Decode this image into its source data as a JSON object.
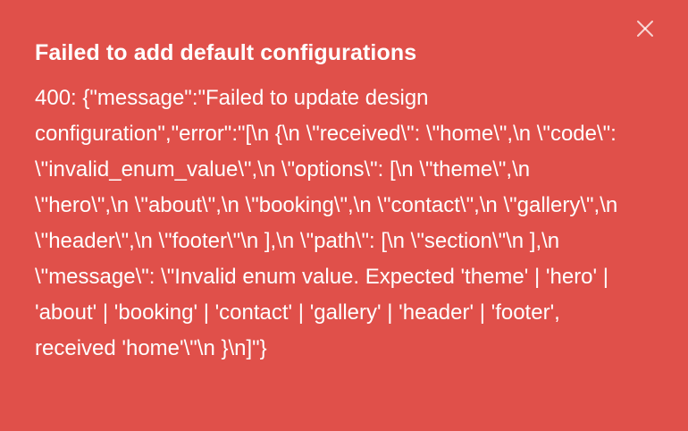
{
  "toast": {
    "title": "Failed to add default configurations",
    "message": "400: {\"message\":\"Failed to update design configuration\",\"error\":\"[\\n {\\n \\\"received\\\": \\\"home\\\",\\n \\\"code\\\": \\\"invalid_enum_value\\\",\\n \\\"options\\\": [\\n \\\"theme\\\",\\n \\\"hero\\\",\\n \\\"about\\\",\\n \\\"booking\\\",\\n \\\"contact\\\",\\n \\\"gallery\\\",\\n \\\"header\\\",\\n \\\"footer\\\"\\n ],\\n \\\"path\\\": [\\n \\\"section\\\"\\n ],\\n \\\"message\\\": \\\"Invalid enum value. Expected 'theme' | 'hero' | 'about' | 'booking' | 'contact' | 'gallery' | 'header' | 'footer', received 'home'\\\"\\n }\\n]\"}",
    "close_icon": "close-icon",
    "background_color": "#e0504a",
    "text_color": "#ffffff"
  }
}
